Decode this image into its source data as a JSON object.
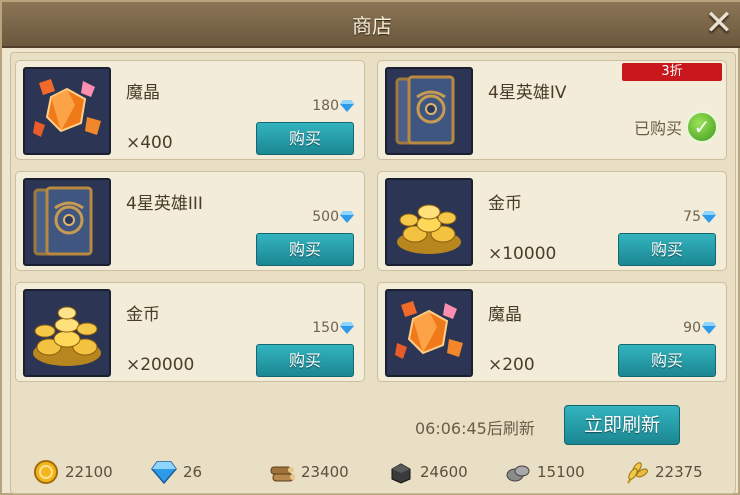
{
  "window": {
    "title": "商店",
    "close_label": "✕"
  },
  "items": [
    {
      "name": "魔晶",
      "price": "180",
      "qty": "×400",
      "buy_label": "购买",
      "icon": "magic-crystal-icon"
    },
    {
      "name": "4星英雄IV",
      "discount": "3折",
      "status": "已购买",
      "icon": "hero-card-icon"
    },
    {
      "name": "4星英雄III",
      "price": "500",
      "buy_label": "购买",
      "icon": "hero-card-icon"
    },
    {
      "name": "金币",
      "price": "75",
      "qty": "×10000",
      "buy_label": "购买",
      "icon": "gold-coins-icon"
    },
    {
      "name": "金币",
      "price": "150",
      "qty": "×20000",
      "buy_label": "购买",
      "icon": "gold-coins-icon"
    },
    {
      "name": "魔晶",
      "price": "90",
      "qty": "×200",
      "buy_label": "购买",
      "icon": "magic-crystal-icon"
    }
  ],
  "refresh": {
    "countdown": "06:06:45后刷新",
    "button_label": "立即刷新"
  },
  "resources": [
    {
      "icon": "gold-coin-icon",
      "value": "22100"
    },
    {
      "icon": "gem-icon",
      "value": "26"
    },
    {
      "icon": "wood-icon",
      "value": "23400"
    },
    {
      "icon": "iron-icon",
      "value": "24600"
    },
    {
      "icon": "stone-icon",
      "value": "15100"
    },
    {
      "icon": "wheat-icon",
      "value": "22375"
    }
  ],
  "colors": {
    "accent_button": "#1f8f9a",
    "discount_badge": "#c9171e"
  }
}
